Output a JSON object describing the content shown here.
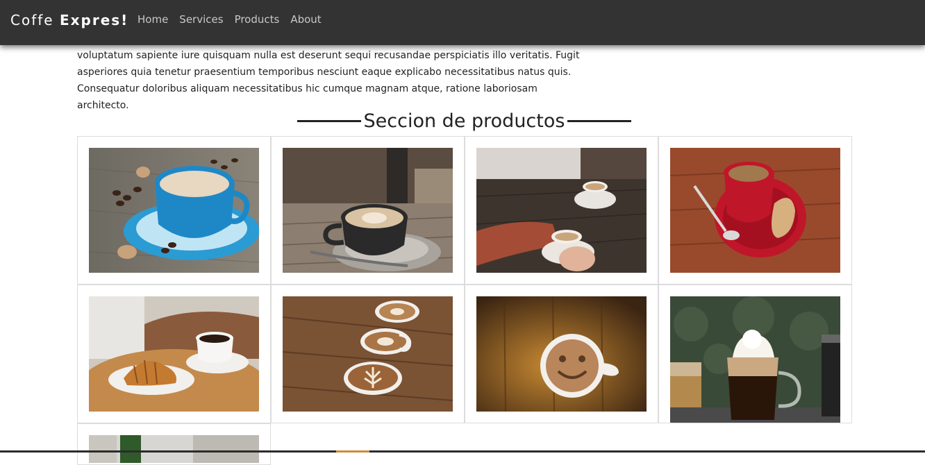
{
  "navbar": {
    "brand_light": "Coffe",
    "brand_bold": "Expres!",
    "links": [
      "Home",
      "Services",
      "Products",
      "About"
    ]
  },
  "intro": {
    "lines": [
      "voluptatum sapiente iure quisquam nulla est deserunt sequi recusandae perspiciatis illo veritatis. Fugit",
      "asperiores quia tenetur praesentium temporibus nesciunt eaque explicabo necessitatibus natus quis.",
      "Consequatur doloribus aliquam necessitatibus hic cumque magnam atque, ratione laboriosam architecto."
    ]
  },
  "products": {
    "title": "Seccion de productos",
    "items": [
      {
        "image": "blue-cup-coffee-beans"
      },
      {
        "image": "dark-cup-latte-art-wood"
      },
      {
        "image": "hands-holding-cup-table"
      },
      {
        "image": "red-cup-saucer-biscotti"
      },
      {
        "image": "coffee-with-croissant"
      },
      {
        "image": "three-latte-art-cups"
      },
      {
        "image": "smiley-face-coffee"
      },
      {
        "image": "whipped-cream-irish-coffee"
      },
      {
        "image": "partial-green-bottle"
      }
    ]
  },
  "colors": {
    "navbar_bg": "#333333",
    "nav_link": "#c8c8c8",
    "brand": "#ffffff",
    "card_border": "#dcdcdc"
  }
}
